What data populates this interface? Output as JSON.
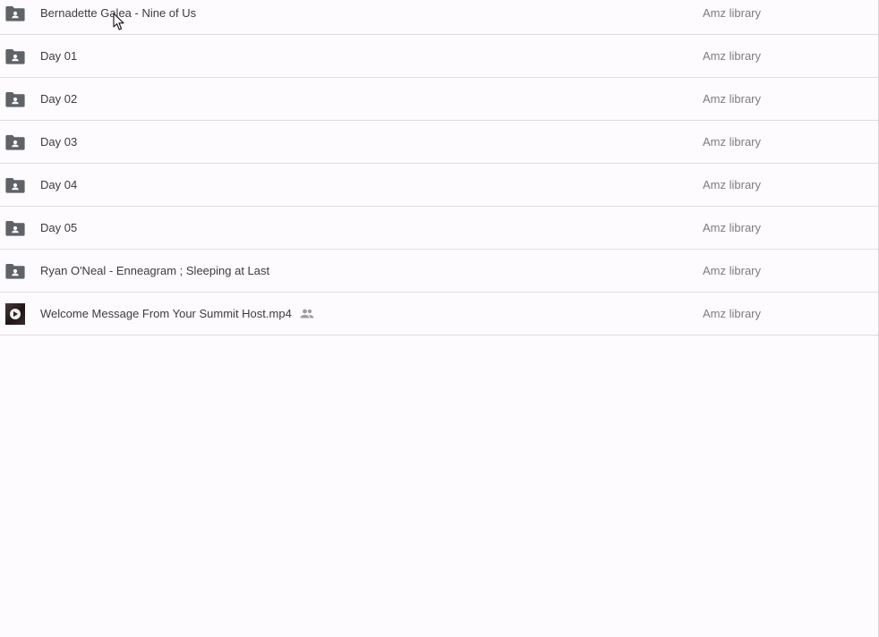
{
  "files": [
    {
      "name": "Bernadette Galea - Nine of Us",
      "owner": "Amz library",
      "type": "shared-folder-icon"
    },
    {
      "name": "Day 01",
      "owner": "Amz library",
      "type": "shared-folder-icon"
    },
    {
      "name": "Day 02",
      "owner": "Amz library",
      "type": "shared-folder-icon"
    },
    {
      "name": "Day 03",
      "owner": "Amz library",
      "type": "shared-folder-icon"
    },
    {
      "name": "Day 04",
      "owner": "Amz library",
      "type": "shared-folder-icon"
    },
    {
      "name": "Day 05",
      "owner": "Amz library",
      "type": "shared-folder-icon"
    },
    {
      "name": "Ryan O'Neal - Enneagram ; Sleeping at Last",
      "owner": "Amz library",
      "type": "shared-folder-icon"
    },
    {
      "name": "Welcome Message From Your Summit Host.mp4",
      "owner": "Amz library",
      "type": "video-thumbnail",
      "shared_indicator": "people-icon"
    }
  ],
  "colors": {
    "background": "#fdfbfd",
    "folder_icon": "#5f6368",
    "name_text": "#3c3c3c",
    "owner_text": "#7d7d7d",
    "divider": "#dedcde"
  }
}
